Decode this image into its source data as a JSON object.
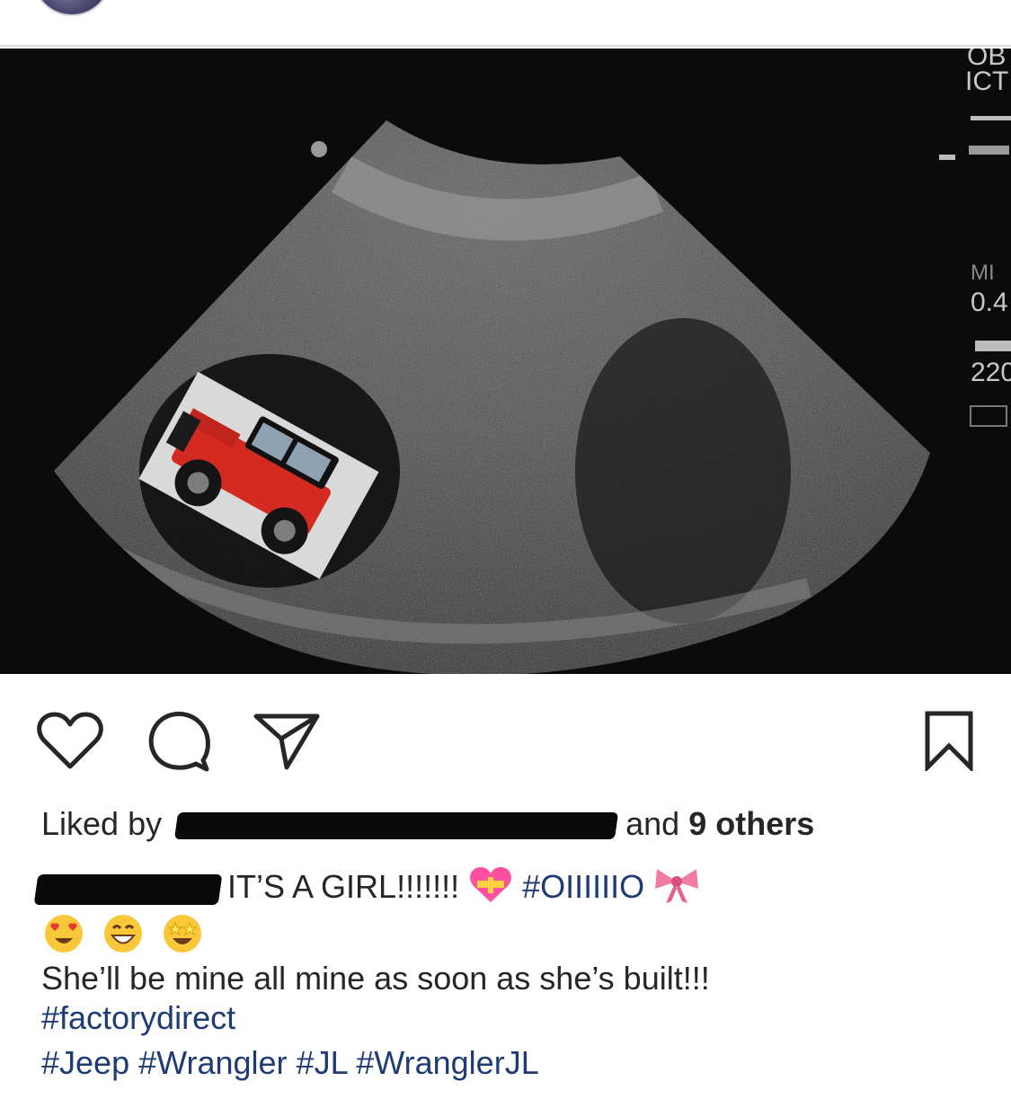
{
  "post": {
    "likes": {
      "prefix": "Liked by",
      "and": "and",
      "others": "9 others"
    },
    "caption": {
      "text": "IT’S A GIRL!!!!!!!",
      "hashtag_oiiiio": "#OIIIIIIO",
      "line2": "She’ll be mine all mine as soon as she’s built!!!",
      "hashtag_factory": "#factorydirect",
      "hashtags": [
        "#Jeep",
        "#Wrangler",
        "#JL",
        "#WranglerJL"
      ]
    }
  },
  "ultrasound": {
    "labels": {
      "top": "OB",
      "ict": "ICT",
      "mi": "MI",
      "mi_value": "0.4",
      "depth": "220"
    }
  },
  "icons": {
    "like": "heart-icon",
    "comment": "comment-bubble-icon",
    "share": "paper-plane-icon",
    "save": "bookmark-icon"
  }
}
